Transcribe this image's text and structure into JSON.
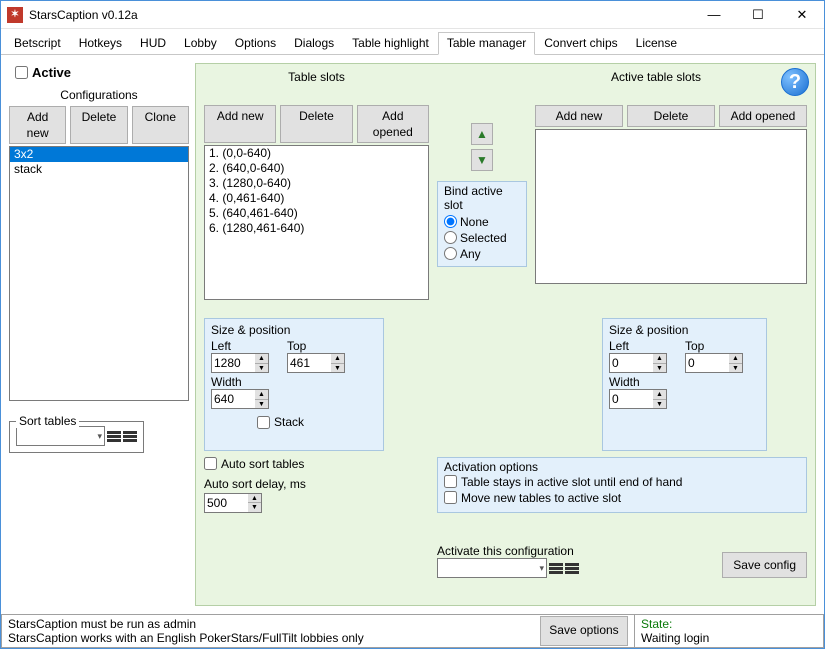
{
  "window": {
    "title": "StarsCaption v0.12a"
  },
  "tabs": [
    "Betscript",
    "Hotkeys",
    "HUD",
    "Lobby",
    "Options",
    "Dialogs",
    "Table highlight",
    "Table manager",
    "Convert chips",
    "License"
  ],
  "active_tab": "Table manager",
  "left": {
    "active_label": "Active",
    "active_checked": false,
    "configurations_label": "Configurations",
    "buttons": {
      "add_new": "Add new",
      "delete": "Delete",
      "clone": "Clone"
    },
    "config_items": [
      "3x2",
      "stack"
    ],
    "config_selected": "3x2",
    "sort_tables_label": "Sort tables",
    "sort_value": ""
  },
  "table_slots": {
    "title": "Table slots",
    "buttons": {
      "add_new": "Add new",
      "delete": "Delete",
      "add_opened": "Add opened"
    },
    "items": [
      "1. (0,0-640)",
      "2. (640,0-640)",
      "3. (1280,0-640)",
      "4. (0,461-640)",
      "5. (640,461-640)",
      "6. (1280,461-640)"
    ],
    "selected_index": 5,
    "sizepos": {
      "title": "Size & position",
      "left_label": "Left",
      "top_label": "Top",
      "width_label": "Width",
      "left": "1280",
      "top": "461",
      "width": "640",
      "stack_label": "Stack",
      "stack_checked": false
    },
    "auto_sort_label": "Auto sort tables",
    "auto_sort_checked": false,
    "auto_sort_delay_label": "Auto sort delay, ms",
    "auto_sort_delay": "500"
  },
  "bind_slot": {
    "title": "Bind active slot",
    "options": {
      "none": "None",
      "selected": "Selected",
      "any": "Any"
    },
    "value": "none"
  },
  "active_table_slots": {
    "title": "Active table slots",
    "buttons": {
      "add_new": "Add new",
      "delete": "Delete",
      "add_opened": "Add opened"
    },
    "items": [],
    "sizepos": {
      "title": "Size & position",
      "left_label": "Left",
      "top_label": "Top",
      "width_label": "Width",
      "left": "0",
      "top": "0",
      "width": "0"
    }
  },
  "activation_options": {
    "title": "Activation options",
    "stay_label": "Table stays in active slot until end of hand",
    "stay_checked": false,
    "move_label": "Move new tables to active slot",
    "move_checked": false
  },
  "activate_config": {
    "label": "Activate this configuration",
    "value": "",
    "save_config": "Save config"
  },
  "status": {
    "line1": "StarsCaption must be run as admin",
    "line2": "StarsCaption works with an English PokerStars/FullTilt lobbies only",
    "save_options": "Save options",
    "state_title": "State:",
    "state_value": "Waiting login"
  }
}
